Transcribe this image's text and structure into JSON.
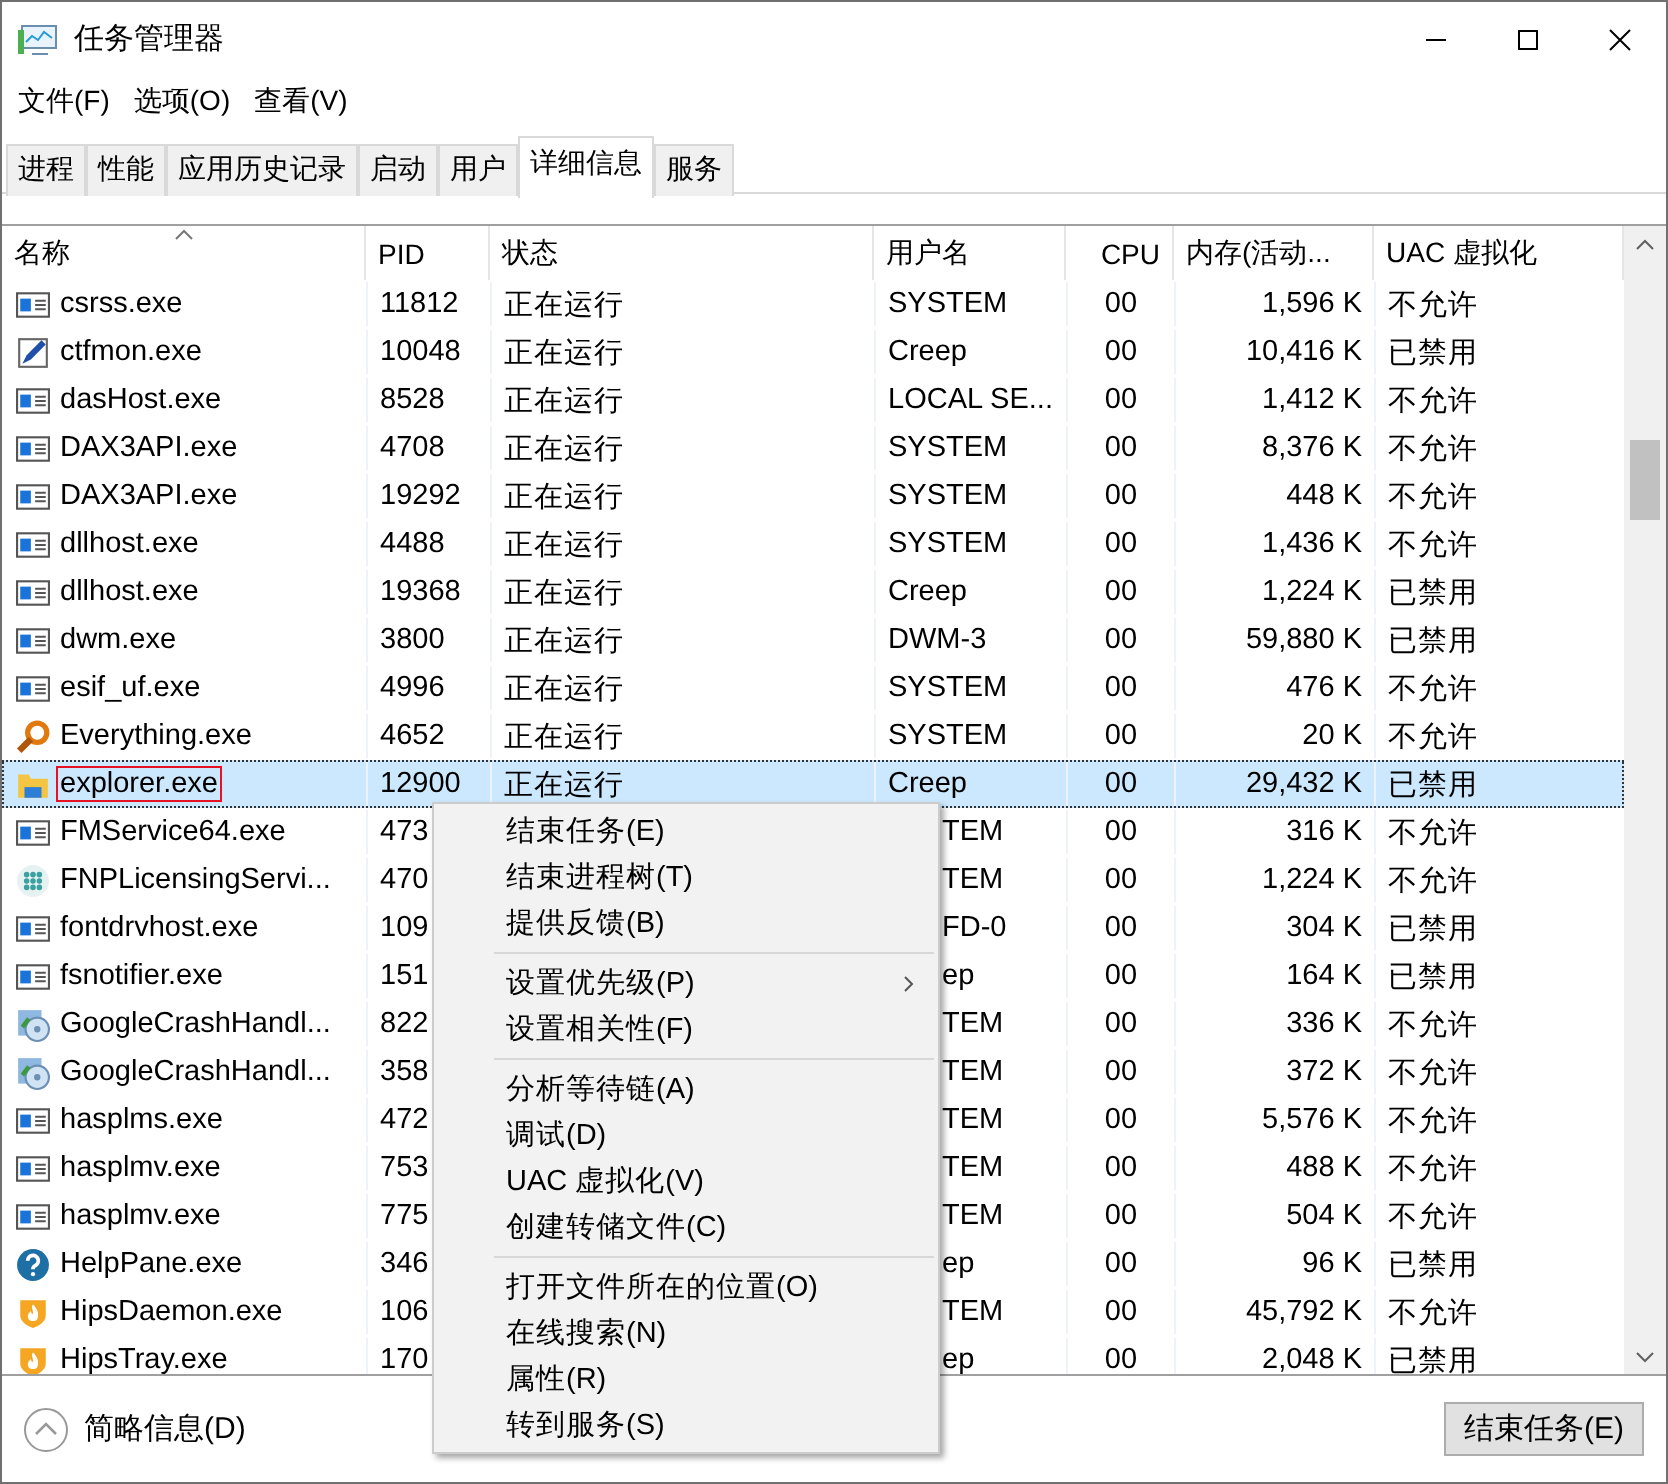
{
  "window": {
    "title": "任务管理器"
  },
  "menu_bar": [
    "文件(F)",
    "选项(O)",
    "查看(V)"
  ],
  "tabs": [
    {
      "label": "进程",
      "selected": false
    },
    {
      "label": "性能",
      "selected": false
    },
    {
      "label": "应用历史记录",
      "selected": false
    },
    {
      "label": "启动",
      "selected": false
    },
    {
      "label": "用户",
      "selected": false
    },
    {
      "label": "详细信息",
      "selected": true
    },
    {
      "label": "服务",
      "selected": false
    }
  ],
  "table": {
    "columns": [
      "名称",
      "PID",
      "状态",
      "用户名",
      "CPU",
      "内存(活动...",
      "UAC 虚拟化"
    ],
    "rows": [
      {
        "kind": "window",
        "name": "csrss.exe",
        "pid": "11812",
        "status": "正在运行",
        "user": "SYSTEM",
        "cpu": "00",
        "memory": "1,596 K",
        "uac": "不允许",
        "selected": false,
        "under_menu": false
      },
      {
        "kind": "pen",
        "name": "ctfmon.exe",
        "pid": "10048",
        "status": "正在运行",
        "user": "Creep",
        "cpu": "00",
        "memory": "10,416 K",
        "uac": "已禁用",
        "selected": false,
        "under_menu": false
      },
      {
        "kind": "window",
        "name": "dasHost.exe",
        "pid": "8528",
        "status": "正在运行",
        "user": "LOCAL SE...",
        "cpu": "00",
        "memory": "1,412 K",
        "uac": "不允许",
        "selected": false,
        "under_menu": false
      },
      {
        "kind": "window",
        "name": "DAX3API.exe",
        "pid": "4708",
        "status": "正在运行",
        "user": "SYSTEM",
        "cpu": "00",
        "memory": "8,376 K",
        "uac": "不允许",
        "selected": false,
        "under_menu": false
      },
      {
        "kind": "window",
        "name": "DAX3API.exe",
        "pid": "19292",
        "status": "正在运行",
        "user": "SYSTEM",
        "cpu": "00",
        "memory": "448 K",
        "uac": "不允许",
        "selected": false,
        "under_menu": false
      },
      {
        "kind": "window",
        "name": "dllhost.exe",
        "pid": "4488",
        "status": "正在运行",
        "user": "SYSTEM",
        "cpu": "00",
        "memory": "1,436 K",
        "uac": "不允许",
        "selected": false,
        "under_menu": false
      },
      {
        "kind": "window",
        "name": "dllhost.exe",
        "pid": "19368",
        "status": "正在运行",
        "user": "Creep",
        "cpu": "00",
        "memory": "1,224 K",
        "uac": "已禁用",
        "selected": false,
        "under_menu": false
      },
      {
        "kind": "window",
        "name": "dwm.exe",
        "pid": "3800",
        "status": "正在运行",
        "user": "DWM-3",
        "cpu": "00",
        "memory": "59,880 K",
        "uac": "已禁用",
        "selected": false,
        "under_menu": false
      },
      {
        "kind": "window",
        "name": "esif_uf.exe",
        "pid": "4996",
        "status": "正在运行",
        "user": "SYSTEM",
        "cpu": "00",
        "memory": "476 K",
        "uac": "不允许",
        "selected": false,
        "under_menu": false
      },
      {
        "kind": "magnifier",
        "name": "Everything.exe",
        "pid": "4652",
        "status": "正在运行",
        "user": "SYSTEM",
        "cpu": "00",
        "memory": "20 K",
        "uac": "不允许",
        "selected": false,
        "under_menu": false
      },
      {
        "kind": "folder",
        "name": "explorer.exe",
        "pid": "12900",
        "status": "正在运行",
        "user": "Creep",
        "cpu": "00",
        "memory": "29,432 K",
        "uac": "已禁用",
        "selected": true,
        "under_menu": false
      },
      {
        "kind": "window",
        "name": "FMService64.exe",
        "pid": "473",
        "user": "TEM",
        "cpu": "00",
        "memory": "316 K",
        "uac": "不允许",
        "selected": false,
        "under_menu": true
      },
      {
        "kind": "dots",
        "name": "FNPLicensingServi...",
        "pid": "470",
        "user": "TEM",
        "cpu": "00",
        "memory": "1,224 K",
        "uac": "不允许",
        "selected": false,
        "under_menu": true
      },
      {
        "kind": "window",
        "name": "fontdrvhost.exe",
        "pid": "109",
        "user": "FD-0",
        "cpu": "00",
        "memory": "304 K",
        "uac": "已禁用",
        "selected": false,
        "under_menu": true
      },
      {
        "kind": "window",
        "name": "fsnotifier.exe",
        "pid": "151",
        "user": "ep",
        "cpu": "00",
        "memory": "164 K",
        "uac": "已禁用",
        "selected": false,
        "under_menu": true
      },
      {
        "kind": "disc",
        "name": "GoogleCrashHandl...",
        "pid": "822",
        "user": "TEM",
        "cpu": "00",
        "memory": "336 K",
        "uac": "不允许",
        "selected": false,
        "under_menu": true
      },
      {
        "kind": "disc",
        "name": "GoogleCrashHandl...",
        "pid": "358",
        "user": "TEM",
        "cpu": "00",
        "memory": "372 K",
        "uac": "不允许",
        "selected": false,
        "under_menu": true
      },
      {
        "kind": "window",
        "name": "hasplms.exe",
        "pid": "472",
        "user": "TEM",
        "cpu": "00",
        "memory": "5,576 K",
        "uac": "不允许",
        "selected": false,
        "under_menu": true
      },
      {
        "kind": "window",
        "name": "hasplmv.exe",
        "pid": "753",
        "user": "TEM",
        "cpu": "00",
        "memory": "488 K",
        "uac": "不允许",
        "selected": false,
        "under_menu": true
      },
      {
        "kind": "window",
        "name": "hasplmv.exe",
        "pid": "775",
        "user": "TEM",
        "cpu": "00",
        "memory": "504 K",
        "uac": "不允许",
        "selected": false,
        "under_menu": true
      },
      {
        "kind": "help",
        "name": "HelpPane.exe",
        "pid": "346",
        "user": "ep",
        "cpu": "00",
        "memory": "96 K",
        "uac": "已禁用",
        "selected": false,
        "under_menu": true
      },
      {
        "kind": "flame",
        "name": "HipsDaemon.exe",
        "pid": "106",
        "user": "TEM",
        "cpu": "00",
        "memory": "45,792 K",
        "uac": "不允许",
        "selected": false,
        "under_menu": true
      },
      {
        "kind": "flame",
        "name": "HipsTray.exe",
        "pid": "170",
        "user": "ep",
        "cpu": "00",
        "memory": "2,048 K",
        "uac": "已禁用",
        "selected": false,
        "under_menu": true
      }
    ]
  },
  "context_menu": {
    "groups": [
      [
        {
          "label": "结束任务(E)",
          "submenu": false
        },
        {
          "label": "结束进程树(T)",
          "submenu": false
        },
        {
          "label": "提供反馈(B)",
          "submenu": false
        }
      ],
      [
        {
          "label": "设置优先级(P)",
          "submenu": true
        },
        {
          "label": "设置相关性(F)",
          "submenu": false
        }
      ],
      [
        {
          "label": "分析等待链(A)",
          "submenu": false
        },
        {
          "label": "调试(D)",
          "submenu": false
        },
        {
          "label": "UAC 虚拟化(V)",
          "submenu": false
        },
        {
          "label": "创建转储文件(C)",
          "submenu": false
        }
      ],
      [
        {
          "label": "打开文件所在的位置(O)",
          "submenu": false
        },
        {
          "label": "在线搜索(N)",
          "submenu": false
        },
        {
          "label": "属性(R)",
          "submenu": false
        },
        {
          "label": "转到服务(S)",
          "submenu": false
        }
      ]
    ]
  },
  "status_bar": {
    "toggle": "简略信息(D)",
    "button": "结束任务(E)"
  }
}
